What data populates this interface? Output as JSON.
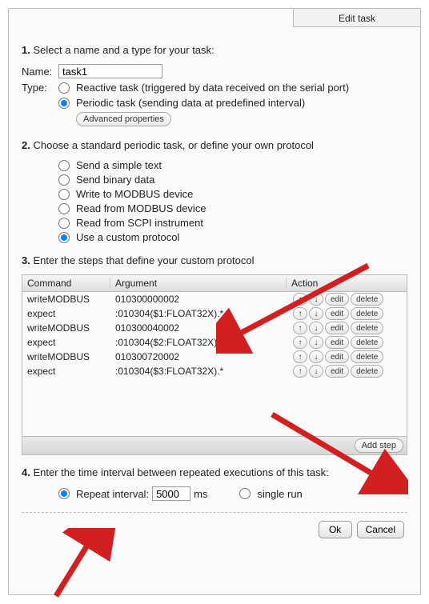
{
  "tab": {
    "title": "Edit task"
  },
  "step1": {
    "heading_num": "1.",
    "heading_text": "Select a name and a type for your task:",
    "name_label": "Name:",
    "name_value": "task1",
    "type_label": "Type:",
    "type_options": {
      "reactive": "Reactive task (triggered by data received on the serial port)",
      "periodic": "Periodic task (sending data at predefined interval)"
    },
    "type_selected": "periodic",
    "advanced_btn": "Advanced properties"
  },
  "step2": {
    "heading_num": "2.",
    "heading_text": "Choose a standard periodic task, or define your own protocol",
    "options": [
      "Send a simple text",
      "Send binary data",
      "Write to MODBUS device",
      "Read from MODBUS device",
      "Read from SCPI instrument",
      "Use a custom protocol"
    ],
    "selected_index": 5
  },
  "step3": {
    "heading_num": "3.",
    "heading_text": "Enter the steps that define your custom protocol",
    "columns": {
      "cmd": "Command",
      "arg": "Argument",
      "act": "Action"
    },
    "rows": [
      {
        "cmd": "writeMODBUS",
        "arg": "010300000002"
      },
      {
        "cmd": "expect",
        "arg": ":010304($1:FLOAT32X).*"
      },
      {
        "cmd": "writeMODBUS",
        "arg": "010300040002"
      },
      {
        "cmd": "expect",
        "arg": ":010304($2:FLOAT32X).*"
      },
      {
        "cmd": "writeMODBUS",
        "arg": "010300720002"
      },
      {
        "cmd": "expect",
        "arg": ":010304($3:FLOAT32X).*"
      }
    ],
    "row_btn_up": "↑",
    "row_btn_down": "↓",
    "row_btn_edit": "edit",
    "row_btn_delete": "delete",
    "add_step_btn": "Add step"
  },
  "step4": {
    "heading_num": "4.",
    "heading_text": "Enter the time interval between repeated executions of this task:",
    "repeat_label": "Repeat interval:",
    "repeat_value": "5000",
    "repeat_unit": "ms",
    "single_label": "single run",
    "selected": "repeat"
  },
  "dialog": {
    "ok": "Ok",
    "cancel": "Cancel"
  },
  "accent_color": "#0a84ff",
  "arrow_color": "#d1201f"
}
